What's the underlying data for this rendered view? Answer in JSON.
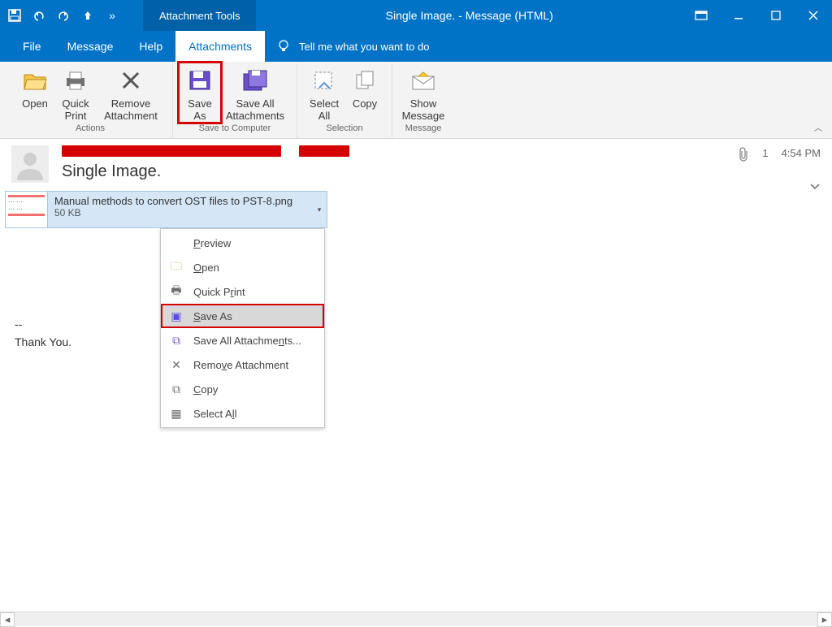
{
  "title": "Single Image.  -  Message (HTML)",
  "contextual_tab": "Attachment Tools",
  "tabs": {
    "file": "File",
    "message": "Message",
    "help": "Help",
    "attachments": "Attachments"
  },
  "tellme": "Tell me what you want to do",
  "ribbon": {
    "open": "Open",
    "quick_print": "Quick\nPrint",
    "remove": "Remove\nAttachment",
    "save_as": "Save\nAs",
    "save_all": "Save All\nAttachments",
    "select_all": "Select\nAll",
    "copy": "Copy",
    "show_message": "Show\nMessage",
    "g_actions": "Actions",
    "g_save": "Save to Computer",
    "g_selection": "Selection",
    "g_message": "Message"
  },
  "header": {
    "subject": "Single Image.",
    "attachment_count": "1",
    "time": "4:54 PM"
  },
  "attachment": {
    "name": "Manual methods to convert OST files to PST-8.png",
    "size": "50 KB"
  },
  "context_menu": {
    "preview": "Preview",
    "open": "Open",
    "quick_print": "Quick Print",
    "save_as": "Save As",
    "save_all": "Save All Attachments...",
    "remove": "Remove Attachment",
    "copy": "Copy",
    "select_all": "Select All"
  },
  "body": {
    "sep": "--",
    "thanks": "Thank You."
  }
}
